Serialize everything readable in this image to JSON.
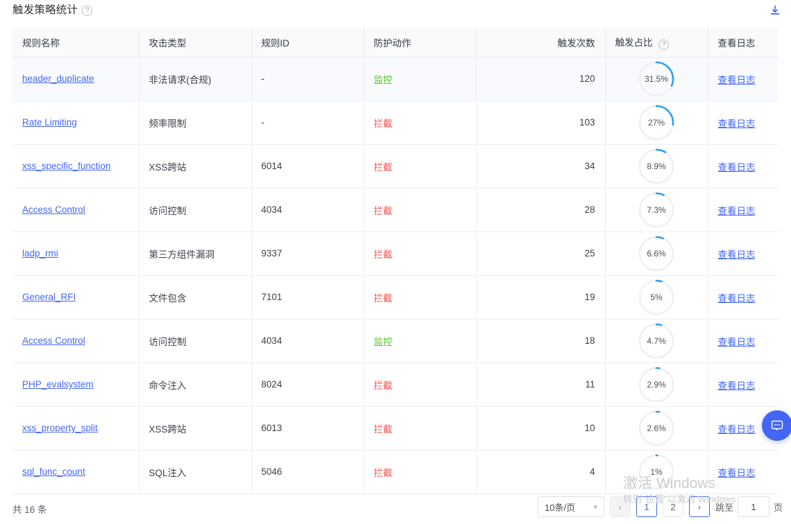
{
  "header": {
    "title": "触发策略统计",
    "help_icon": "question-circle-icon",
    "download_icon": "download-icon"
  },
  "table": {
    "columns": [
      {
        "key": "rule_name",
        "label": "规则名称"
      },
      {
        "key": "attack_type",
        "label": "攻击类型"
      },
      {
        "key": "rule_id",
        "label": "规则ID"
      },
      {
        "key": "action",
        "label": "防护动作"
      },
      {
        "key": "count",
        "label": "触发次数"
      },
      {
        "key": "ratio",
        "label": "触发占比"
      },
      {
        "key": "log",
        "label": "查看日志"
      }
    ],
    "ratio_help_icon": "question-circle-icon",
    "rows": [
      {
        "rule_name": "header_duplicate",
        "attack_type": "非法请求(合规)",
        "rule_id": "-",
        "action": "监控",
        "action_kind": "monitor",
        "count": "120",
        "ratio": "31.5%",
        "ratio_value": 31.5,
        "log": "查看日志",
        "highlight": true
      },
      {
        "rule_name": "Rate Limiting",
        "attack_type": "频率限制",
        "rule_id": "-",
        "action": "拦截",
        "action_kind": "block",
        "count": "103",
        "ratio": "27%",
        "ratio_value": 27,
        "log": "查看日志",
        "highlight": false
      },
      {
        "rule_name": "xss_specific_function",
        "attack_type": "XSS跨站",
        "rule_id": "6014",
        "action": "拦截",
        "action_kind": "block",
        "count": "34",
        "ratio": "8.9%",
        "ratio_value": 8.9,
        "log": "查看日志",
        "highlight": false
      },
      {
        "rule_name": "Access Control",
        "attack_type": "访问控制",
        "rule_id": "4034",
        "action": "拦截",
        "action_kind": "block",
        "count": "28",
        "ratio": "7.3%",
        "ratio_value": 7.3,
        "log": "查看日志",
        "highlight": false
      },
      {
        "rule_name": "ladp_rmi",
        "attack_type": "第三方组件漏洞",
        "rule_id": "9337",
        "action": "拦截",
        "action_kind": "block",
        "count": "25",
        "ratio": "6.6%",
        "ratio_value": 6.6,
        "log": "查看日志",
        "highlight": false
      },
      {
        "rule_name": "General_RFI",
        "attack_type": "文件包含",
        "rule_id": "7101",
        "action": "拦截",
        "action_kind": "block",
        "count": "19",
        "ratio": "5%",
        "ratio_value": 5,
        "log": "查看日志",
        "highlight": false
      },
      {
        "rule_name": "Access Control",
        "attack_type": "访问控制",
        "rule_id": "4034",
        "action": "监控",
        "action_kind": "monitor",
        "count": "18",
        "ratio": "4.7%",
        "ratio_value": 4.7,
        "log": "查看日志",
        "highlight": false
      },
      {
        "rule_name": "PHP_evalsystem",
        "attack_type": "命令注入",
        "rule_id": "8024",
        "action": "拦截",
        "action_kind": "block",
        "count": "11",
        "ratio": "2.9%",
        "ratio_value": 2.9,
        "log": "查看日志",
        "highlight": false
      },
      {
        "rule_name": "xss_property_split",
        "attack_type": "XSS跨站",
        "rule_id": "6013",
        "action": "拦截",
        "action_kind": "block",
        "count": "10",
        "ratio": "2.6%",
        "ratio_value": 2.6,
        "log": "查看日志",
        "highlight": false
      },
      {
        "rule_name": "sql_func_count",
        "attack_type": "SQL注入",
        "rule_id": "5046",
        "action": "拦截",
        "action_kind": "block",
        "count": "4",
        "ratio": "1%",
        "ratio_value": 1,
        "log": "查看日志",
        "highlight": false
      }
    ]
  },
  "footer": {
    "total_text": "共 16 条",
    "page_size": "10条/页",
    "prev_label": "‹",
    "next_label": "›",
    "pages": [
      "1",
      "2"
    ],
    "current_page": "1",
    "jump_label": "跳至",
    "jump_value": "1",
    "page_unit": "页"
  },
  "watermark": {
    "line1": "激活 Windows",
    "line2": "转到\"设置\"以激活 Windows"
  },
  "chat": {
    "icon": "chat-bubble-icon"
  },
  "colors": {
    "accent": "#4366f6",
    "monitor": "#52c41a",
    "block": "#f5534f",
    "ring_track": "#eef0f3",
    "ring_fill": "#2f9cf4",
    "row_highlight": "#f8fafd"
  }
}
